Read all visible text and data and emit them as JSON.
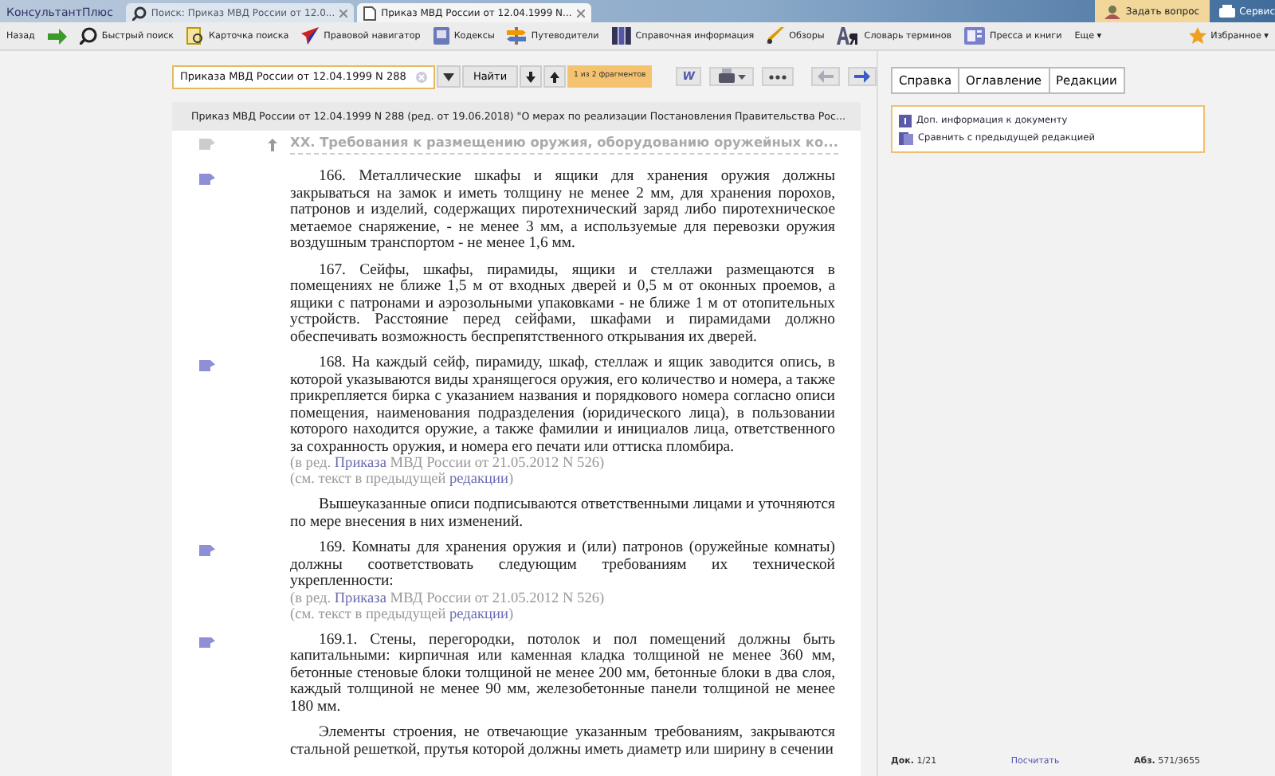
{
  "app_name": "КонсультантПлюс",
  "browser_tabs": [
    {
      "label": "Поиск: Приказ МВД России от 12.0...",
      "kind": "search",
      "selected": false
    },
    {
      "label": "Приказ МВД России от 12.04.1999 N...",
      "kind": "doc",
      "selected": true
    }
  ],
  "top_actions": [
    {
      "label": "Задать вопрос",
      "kind": "ask"
    },
    {
      "label": "Сервис",
      "kind": "services"
    }
  ],
  "toolbar": [
    {
      "label": "Назад",
      "kind": "text"
    },
    {
      "kind": "forward"
    },
    {
      "label": "Быстрый поиск",
      "kind": "search"
    },
    {
      "label": "Карточка поиска",
      "kind": "card"
    },
    {
      "label": "Правовой навигатор",
      "kind": "navigator"
    },
    {
      "label": "Кодексы",
      "kind": "book"
    },
    {
      "label": "Путеводители",
      "kind": "signpost"
    },
    {
      "label": "Справочная информация",
      "kind": "binders"
    },
    {
      "label": "Обзоры",
      "kind": "pen"
    },
    {
      "label": "Словарь терминов",
      "kind": "dict"
    },
    {
      "label": "Пресса и книги",
      "kind": "press"
    },
    {
      "label": "Еще ▾",
      "kind": "text"
    }
  ],
  "favorites": "Избранное ▾",
  "search": {
    "value": "Приказа МВД России от 12.04.1999 N 288",
    "find": "Найти",
    "result": "1 из 2 фрагментов"
  },
  "word_button": "W",
  "panel_tabs": [
    {
      "label": "Справка",
      "selected": false
    },
    {
      "label": "Оглавление",
      "selected": false
    },
    {
      "label": "Редакции",
      "selected": false
    }
  ],
  "document": {
    "title": "Приказ МВД России от 12.04.1999 N 288 (ред. от 19.06.2018) \"О мерах по реализации Постановления Правительства Рос...",
    "heading": "XX. Требования к размещению оружия, оборудованию оружейных ко...",
    "paragraphs": [
      {
        "marker": true,
        "text": "166. Металлические шкафы и ящики для хранения оружия должны закрываться на замок и иметь толщину не менее 2 мм, для хранения порохов, патронов и изделий, содержащих пиротехнический заряд либо пиротехническое метаемое снаряжение, - не менее 3 мм, а используемые для перевозки оружия воздушным транспортом - не менее 1,6 мм."
      },
      {
        "marker": false,
        "text": "167. Сейфы, шкафы, пирамиды, ящики и стеллажи размещаются в помещениях не ближе 1,5 м от входных дверей и 0,5 м от оконных проемов, а ящики с патронами и аэрозольными упаковками - не ближе 1 м от отопительных устройств. Расстояние перед сейфами, шкафами и пирамидами должно обеспечивать возможность беспрепятственного открывания их дверей."
      },
      {
        "marker": true,
        "text": "168. На каждый сейф, пирамиду, шкаф, стеллаж и ящик заводится опись, в которой указываются виды хранящегося оружия, его количество и номера, а также прикрепляется бирка с указанием названия и порядкового номера согласно описи помещения, наименования подразделения (юридического лица), в пользовании которого находится оружие, а также фамилии и инициалов лица, ответственного за сохранность оружия, и номера его печати или оттиска пломбира.",
        "notes": [
          {
            "before": "(в ред. ",
            "link": "Приказа",
            "after": " МВД России от 21.05.2012 N 526)"
          },
          {
            "before": "(см. текст в предыдущей ",
            "link": "редакции",
            "after": ")"
          }
        ]
      },
      {
        "marker": false,
        "text": "Вышеуказанные описи подписываются ответственными лицами и уточняются по мере внесения в них изменений."
      },
      {
        "marker": true,
        "text": "169. Комнаты для хранения оружия и (или) патронов (оружейные комнаты) должны соответствовать следующим требованиям их технической укрепленности:",
        "notes": [
          {
            "before": "(в ред. ",
            "link": "Приказа",
            "after": " МВД России от 21.05.2012 N 526)"
          },
          {
            "before": "(см. текст в предыдущей ",
            "link": "редакции",
            "after": ")"
          }
        ]
      },
      {
        "marker": true,
        "text": "169.1. Стены, перегородки, потолок и пол помещений должны быть капитальными: кирпичная или каменная кладка толщиной не менее 360 мм, бетонные стеновые блоки толщиной не менее 200 мм, бетонные блоки в два слоя, каждый толщиной не менее 90 мм, железобетонные панели толщиной не менее 180 мм."
      },
      {
        "marker": false,
        "text": "Элементы строения, не отвечающие указанным требованиям, закрываются стальной решеткой, прутья которой должны иметь диаметр или ширину в сечении"
      }
    ]
  },
  "info_links": [
    {
      "label": "Доп. информация к документу",
      "kind": "info"
    },
    {
      "label": "Сравнить с предыдущей редакцией",
      "kind": "compare"
    }
  ],
  "status": {
    "doc": "**Док.** 1/21",
    "count": "Посчитать",
    "para": "**Абз.** 571/3655"
  }
}
